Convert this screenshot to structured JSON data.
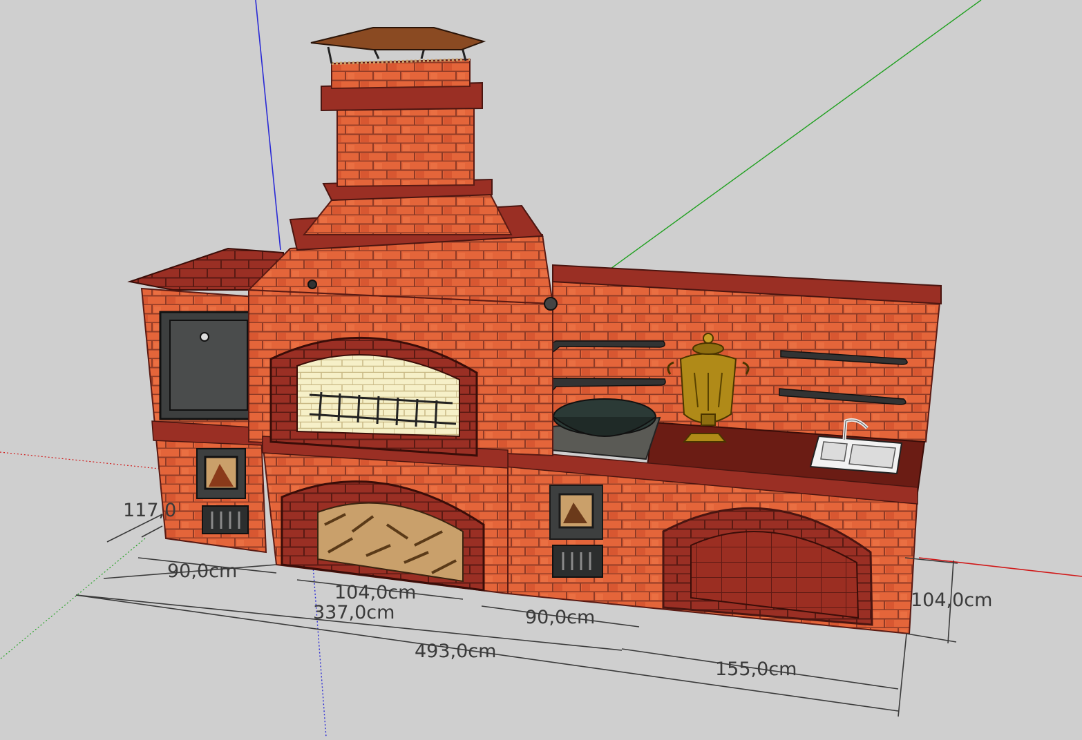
{
  "scene": {
    "background": "#cfcfcf",
    "axis_colors": {
      "blue": "#2a2ad6",
      "green": "#1fa01f",
      "red": "#d01818"
    },
    "colors": {
      "brick": "#e4653a",
      "brick_dark": "#8e2d22",
      "mortar": "#9a4530",
      "countertop": "#6b1c14",
      "metal": "#3d3f3f",
      "firebox": "#f4eec0",
      "roof": "#8a4a22",
      "brass": "#b08a18"
    }
  },
  "dimensions": {
    "d117": "117,0",
    "d90_left": "90,0cm",
    "d104_front": "104,0cm",
    "d337": "337,0cm",
    "d90_right": "90,0cm",
    "d493": "493,0cm",
    "d155": "155,0cm",
    "d104_height": "104,0cm"
  },
  "objects": {
    "chimney": "chimney-icon",
    "grill": "grill-icon",
    "oven_door": "oven-door-icon",
    "firewood": "firewood-icon",
    "kazan": "kazan-icon",
    "samovar": "samovar-icon",
    "sink": "sink-icon",
    "shelves": "shelf-icon"
  }
}
